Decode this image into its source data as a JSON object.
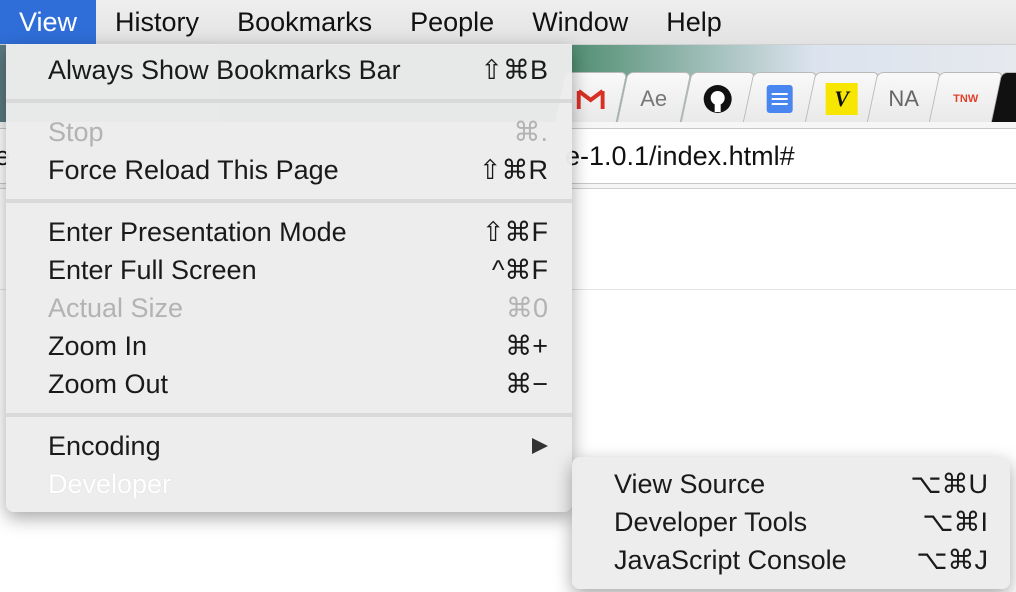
{
  "menubar": {
    "items": [
      "View",
      "History",
      "Bookmarks",
      "People",
      "Window",
      "Help"
    ]
  },
  "browser": {
    "url_fragment": "e-1.0.1/index.html#",
    "tab_favicons": [
      "gmail-icon",
      "ae-icon",
      "github-icon",
      "docs-icon",
      "v-icon",
      "na-icon",
      "tnw-icon",
      "dark-icon"
    ],
    "tab_texts": [
      "Ae",
      "NA",
      "TNW"
    ]
  },
  "view_menu": {
    "always_show_bookmarks": {
      "label": "Always Show Bookmarks Bar",
      "shortcut": "⇧⌘B"
    },
    "stop": {
      "label": "Stop",
      "shortcut": "⌘."
    },
    "force_reload": {
      "label": "Force Reload This Page",
      "shortcut": "⇧⌘R"
    },
    "presentation_mode": {
      "label": "Enter Presentation Mode",
      "shortcut": "⇧⌘F"
    },
    "full_screen": {
      "label": "Enter Full Screen",
      "shortcut": "^⌘F"
    },
    "actual_size": {
      "label": "Actual Size",
      "shortcut": "⌘0"
    },
    "zoom_in": {
      "label": "Zoom In",
      "shortcut": "⌘+"
    },
    "zoom_out": {
      "label": "Zoom Out",
      "shortcut": "⌘−"
    },
    "encoding": {
      "label": "Encoding"
    },
    "developer": {
      "label": "Developer"
    }
  },
  "developer_submenu": {
    "view_source": {
      "label": "View Source",
      "shortcut": "⌥⌘U"
    },
    "developer_tools": {
      "label": "Developer Tools",
      "shortcut": "⌥⌘I"
    },
    "js_console": {
      "label": "JavaScript Console",
      "shortcut": "⌥⌘J"
    }
  },
  "colors": {
    "menubar_highlight": "#2f6ed8",
    "menu_bg": "#ececec",
    "disabled_text": "#b3b3b3"
  }
}
